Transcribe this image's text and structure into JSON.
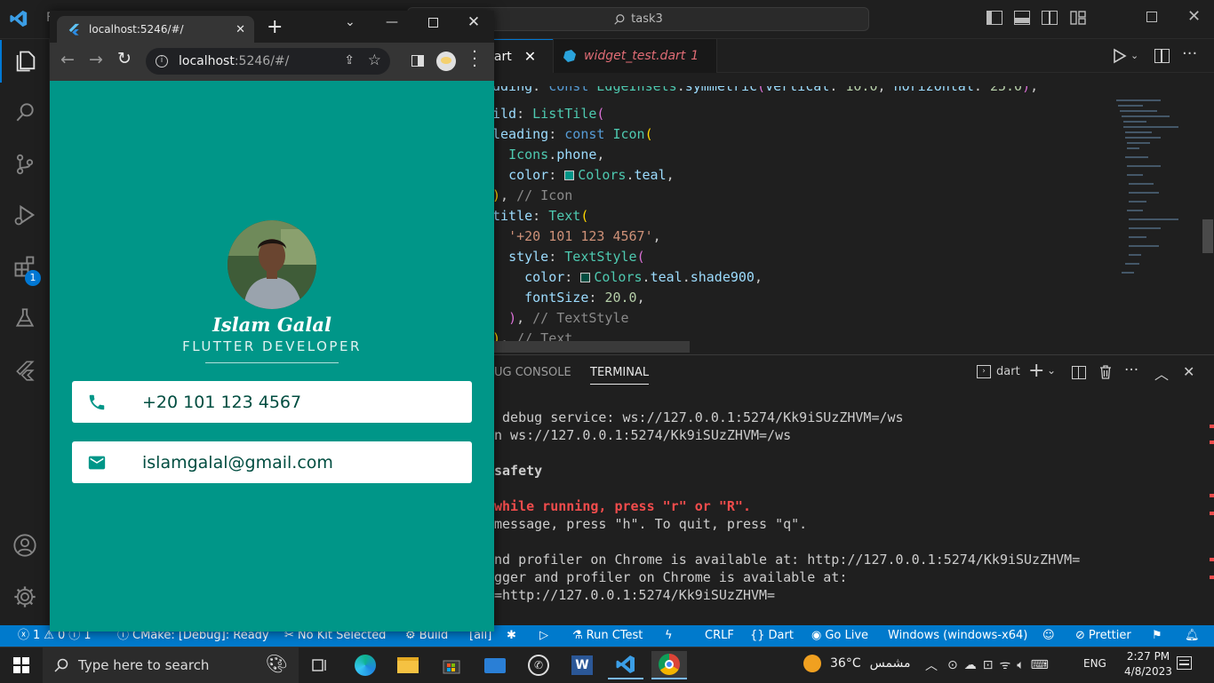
{
  "vscode": {
    "title_search": "task3",
    "title_letter": "F",
    "tabs": [
      {
        "label": "lart",
        "active": true
      },
      {
        "label": "widget_test.dart",
        "badge": "1"
      }
    ],
    "code_lines": [
      "dding: const EdgeInsets.symmetric(vertical: 10.0, horizontal: 25.0),",
      "ild: ListTile(",
      "leading: const Icon(",
      "  Icons.phone,",
      "  color: Colors.teal,",
      "), // Icon",
      "title: Text(",
      "  '+20 101 123 4567',",
      "  style: TextStyle(",
      "    color: Colors.teal.shade900,",
      "    fontSize: 20.0,",
      "  ), // TextStyle",
      "), // Text"
    ],
    "panel_tabs": [
      "UG CONSOLE",
      "TERMINAL"
    ],
    "terminal_profile": "dart",
    "terminal_lines": [
      {
        "text": " debug service: ws://127.0.0.1:5274/Kk9iSUzZHVM=/ws",
        "style": "normal"
      },
      {
        "text": "n ws://127.0.0.1:5274/Kk9iSUzZHVM=/ws",
        "style": "normal"
      },
      {
        "text": "",
        "style": "normal"
      },
      {
        "text": "safety",
        "style": "bold"
      },
      {
        "text": "",
        "style": "normal"
      },
      {
        "text": "while running, press \"r\" or \"R\".",
        "style": "red"
      },
      {
        "text": "message, press \"h\". To quit, press \"q\".",
        "style": "normal"
      },
      {
        "text": "",
        "style": "normal"
      },
      {
        "text": "nd profiler on Chrome is available at: http://127.0.0.1:5274/Kk9iSUzZHVM=",
        "style": "normal"
      },
      {
        "text": "gger and profiler on Chrome is available at:",
        "style": "normal"
      },
      {
        "text": "=http://127.0.0.1:5274/Kk9iSUzZHVM=",
        "style": "normal"
      }
    ],
    "status": {
      "errors": "1",
      "warnings": "0",
      "infos": "1",
      "cmake": "CMake: [Debug]: Ready",
      "kit": "No Kit Selected",
      "build": "Build",
      "all": "[all]",
      "run_ctest": "Run CTest",
      "eol": "CRLF",
      "language": "Dart",
      "go_live": "Go Live",
      "platform": "Windows (windows-x64)",
      "prettier": "Prettier"
    },
    "activity_badge": "1"
  },
  "chrome": {
    "tab_title": "localhost:5246/#/",
    "url_host": "localhost",
    "url_rest": ":5246/#/"
  },
  "app": {
    "name": "Islam Galal",
    "role": "FLUTTER DEVELOPER",
    "phone": "+20 101 123 4567",
    "email": "islamgalal@gmail.com",
    "teal": "#009688",
    "text_color": "#004d40"
  },
  "taskbar": {
    "search_placeholder": "Type here to search",
    "weather_temp": "36°C",
    "weather_city": "مشمس",
    "language": "ENG",
    "time": "2:27 PM",
    "date": "4/8/2023"
  }
}
